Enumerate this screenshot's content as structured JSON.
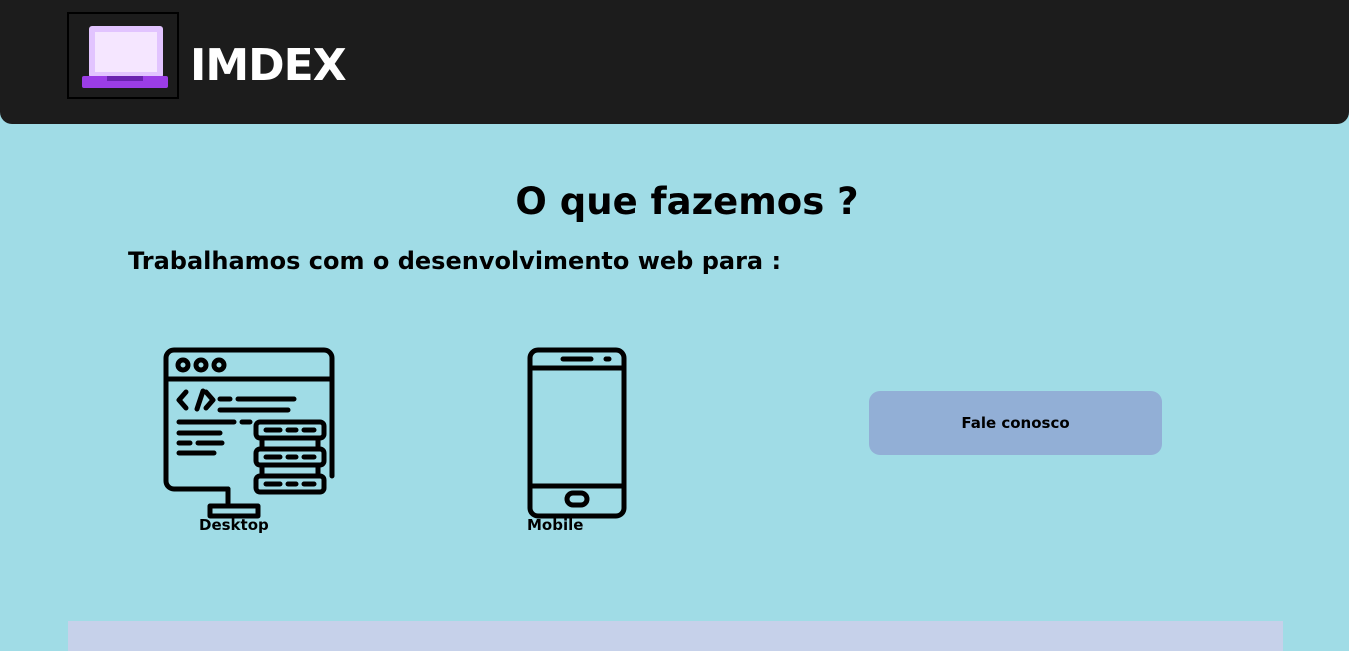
{
  "header": {
    "brand": "IMDEX",
    "logo_icon": "laptop-icon"
  },
  "main": {
    "title": "O que fazemos ?",
    "subtitle": "Trabalhamos com o desenvolvimento web para :",
    "services": [
      {
        "label": "Desktop",
        "icon": "desktop-code-icon"
      },
      {
        "label": "Mobile",
        "icon": "smartphone-icon"
      }
    ],
    "contact_button": "Fale conosco"
  },
  "colors": {
    "page_background": "#a0dce6",
    "header_background": "#1c1c1c",
    "button_background": "#92afd6",
    "footer_band": "#c6d1ea",
    "logo_purple": "#9b3de6"
  }
}
